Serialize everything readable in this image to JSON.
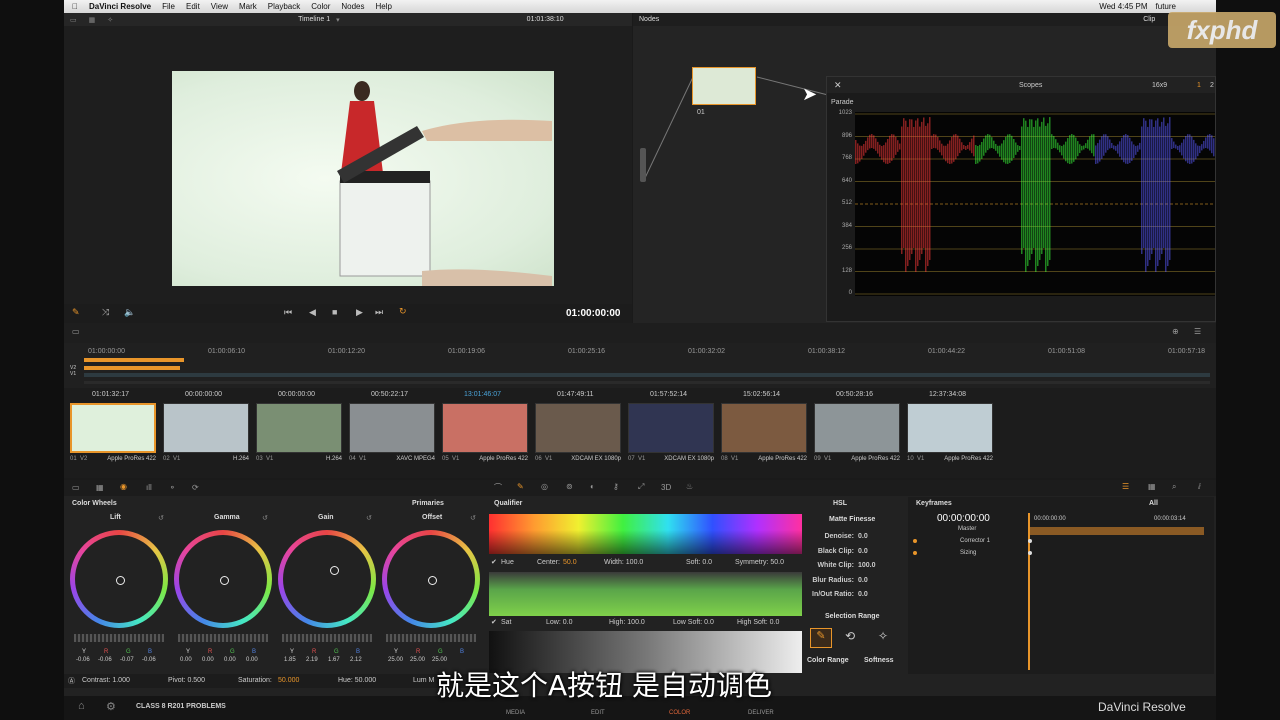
{
  "macbar": {
    "apple": "",
    "app_name": "DaVinci Resolve",
    "menu": [
      "File",
      "Edit",
      "View",
      "Mark",
      "Playback",
      "Color",
      "Nodes",
      "Help"
    ],
    "datetime": "Wed 4:45 PM",
    "user": "future"
  },
  "viewer": {
    "timeline_name": "Timeline 1",
    "header_tc": "01:01:38:10",
    "timecode": "01:00:00:00"
  },
  "nodes": {
    "title": "Nodes",
    "clip_label": "Clip",
    "node_label": "01"
  },
  "scopes": {
    "title": "Scopes",
    "aspect": "16x9",
    "ch1": "1",
    "ch2": "2",
    "mode": "Parade",
    "y_ticks": [
      "1023",
      "896",
      "768",
      "640",
      "512",
      "384",
      "256",
      "128",
      "0"
    ]
  },
  "timeline": {
    "ruler": [
      "01:00:00:00",
      "01:00:06:10",
      "01:00:12:20",
      "01:00:19:06",
      "01:00:25:16",
      "01:00:32:02",
      "01:00:38:12",
      "01:00:44:22",
      "01:00:51:08",
      "01:00:57:18"
    ],
    "v2": "V2",
    "v1": "V1"
  },
  "clips": [
    {
      "tc": "01:01:32:17",
      "num": "01",
      "track": "V2",
      "codec": "Apple ProRes 422",
      "color": "#dff0dc"
    },
    {
      "tc": "00:00:00:00",
      "num": "02",
      "track": "V1",
      "codec": "H.264",
      "color": "#b9c4c9"
    },
    {
      "tc": "00:00:00:00",
      "num": "03",
      "track": "V1",
      "codec": "H.264",
      "color": "#7a8f73"
    },
    {
      "tc": "00:50:22:17",
      "num": "04",
      "track": "V1",
      "codec": "XAVC MPEG4",
      "color": "#8a8f92"
    },
    {
      "tc": "13:01:46:07",
      "num": "05",
      "track": "V1",
      "codec": "Apple ProRes 422",
      "color": "#c97064"
    },
    {
      "tc": "01:47:49:11",
      "num": "06",
      "track": "V1",
      "codec": "XDCAM EX 1080p",
      "color": "#6a5a4c"
    },
    {
      "tc": "01:57:52:14",
      "num": "07",
      "track": "V1",
      "codec": "XDCAM EX 1080p",
      "color": "#303552"
    },
    {
      "tc": "15:02:56:14",
      "num": "08",
      "track": "V1",
      "codec": "Apple ProRes 422",
      "color": "#7c5a40"
    },
    {
      "tc": "00:50:28:16",
      "num": "09",
      "track": "V1",
      "codec": "Apple ProRes 422",
      "color": "#8d9598"
    },
    {
      "tc": "12:37:34:08",
      "num": "10",
      "track": "V1",
      "codec": "Apple ProRes 422",
      "color": "#bfcdd3"
    }
  ],
  "colorwheels": {
    "title": "Color Wheels",
    "mode": "Primaries",
    "wheels": [
      {
        "label": "Lift",
        "vals": [
          "-0.06",
          "-0.06",
          "-0.07",
          "-0.06"
        ]
      },
      {
        "label": "Gamma",
        "vals": [
          "0.00",
          "0.00",
          "0.00",
          "0.00"
        ]
      },
      {
        "label": "Gain",
        "vals": [
          "1.85",
          "2.19",
          "1.67",
          "2.12"
        ]
      },
      {
        "label": "Offset",
        "vals": [
          "25.00",
          "25.00",
          "25.00",
          ""
        ]
      }
    ],
    "chan": [
      "Y",
      "R",
      "G",
      "B"
    ],
    "contrast": "Contrast: 1.000",
    "pivot": "Pivot: 0.500",
    "saturation_label": "Saturation: ",
    "saturation_val": "50.000",
    "hue": "Hue: 50.000",
    "lum": "Lum M"
  },
  "qualifier": {
    "title": "Qualifier",
    "mode": "HSL",
    "hue_row": {
      "label": "Hue",
      "center_label": "Center:",
      "center": "50.0",
      "width": "Width: 100.0",
      "soft": "Soft: 0.0",
      "symmetry": "Symmetry: 50.0"
    },
    "sat_row": {
      "label": "Sat",
      "low": "Low: 0.0",
      "high": "High: 100.0",
      "lowsoft": "Low Soft: 0.0",
      "highsoft": "High Soft: 0.0"
    },
    "matte_title": "Matte Finesse",
    "matte": [
      {
        "k": "Denoise:",
        "v": "0.0"
      },
      {
        "k": "Black Clip:",
        "v": "0.0"
      },
      {
        "k": "White Clip:",
        "v": "100.0"
      },
      {
        "k": "Blur Radius:",
        "v": "0.0"
      },
      {
        "k": "In/Out Ratio:",
        "v": "0.0"
      }
    ],
    "selection_range": "Selection Range",
    "color_range": "Color Range",
    "softness": "Softness"
  },
  "keyframes": {
    "title": "Keyframes",
    "filter": "All",
    "tc": "00:00:00:00",
    "ruler_start": "00:00:00:00",
    "ruler_end": "00:00:03:14",
    "rows": [
      "Master",
      "Corrector 1",
      "Sizing"
    ]
  },
  "footer": {
    "project": "CLASS 8 R201 PROBLEMS",
    "tabs": [
      "MEDIA",
      "EDIT",
      "COLOR",
      "DELIVER"
    ],
    "brand": "DaVinci Resolve"
  },
  "overlay": {
    "subtitle": "就是这个A按钮 是自动调色",
    "logo": "fxphd"
  },
  "colors": {
    "accent": "#e8952a",
    "selected_tab": "#e0663a",
    "teal_tc": "#4aa3d8"
  }
}
